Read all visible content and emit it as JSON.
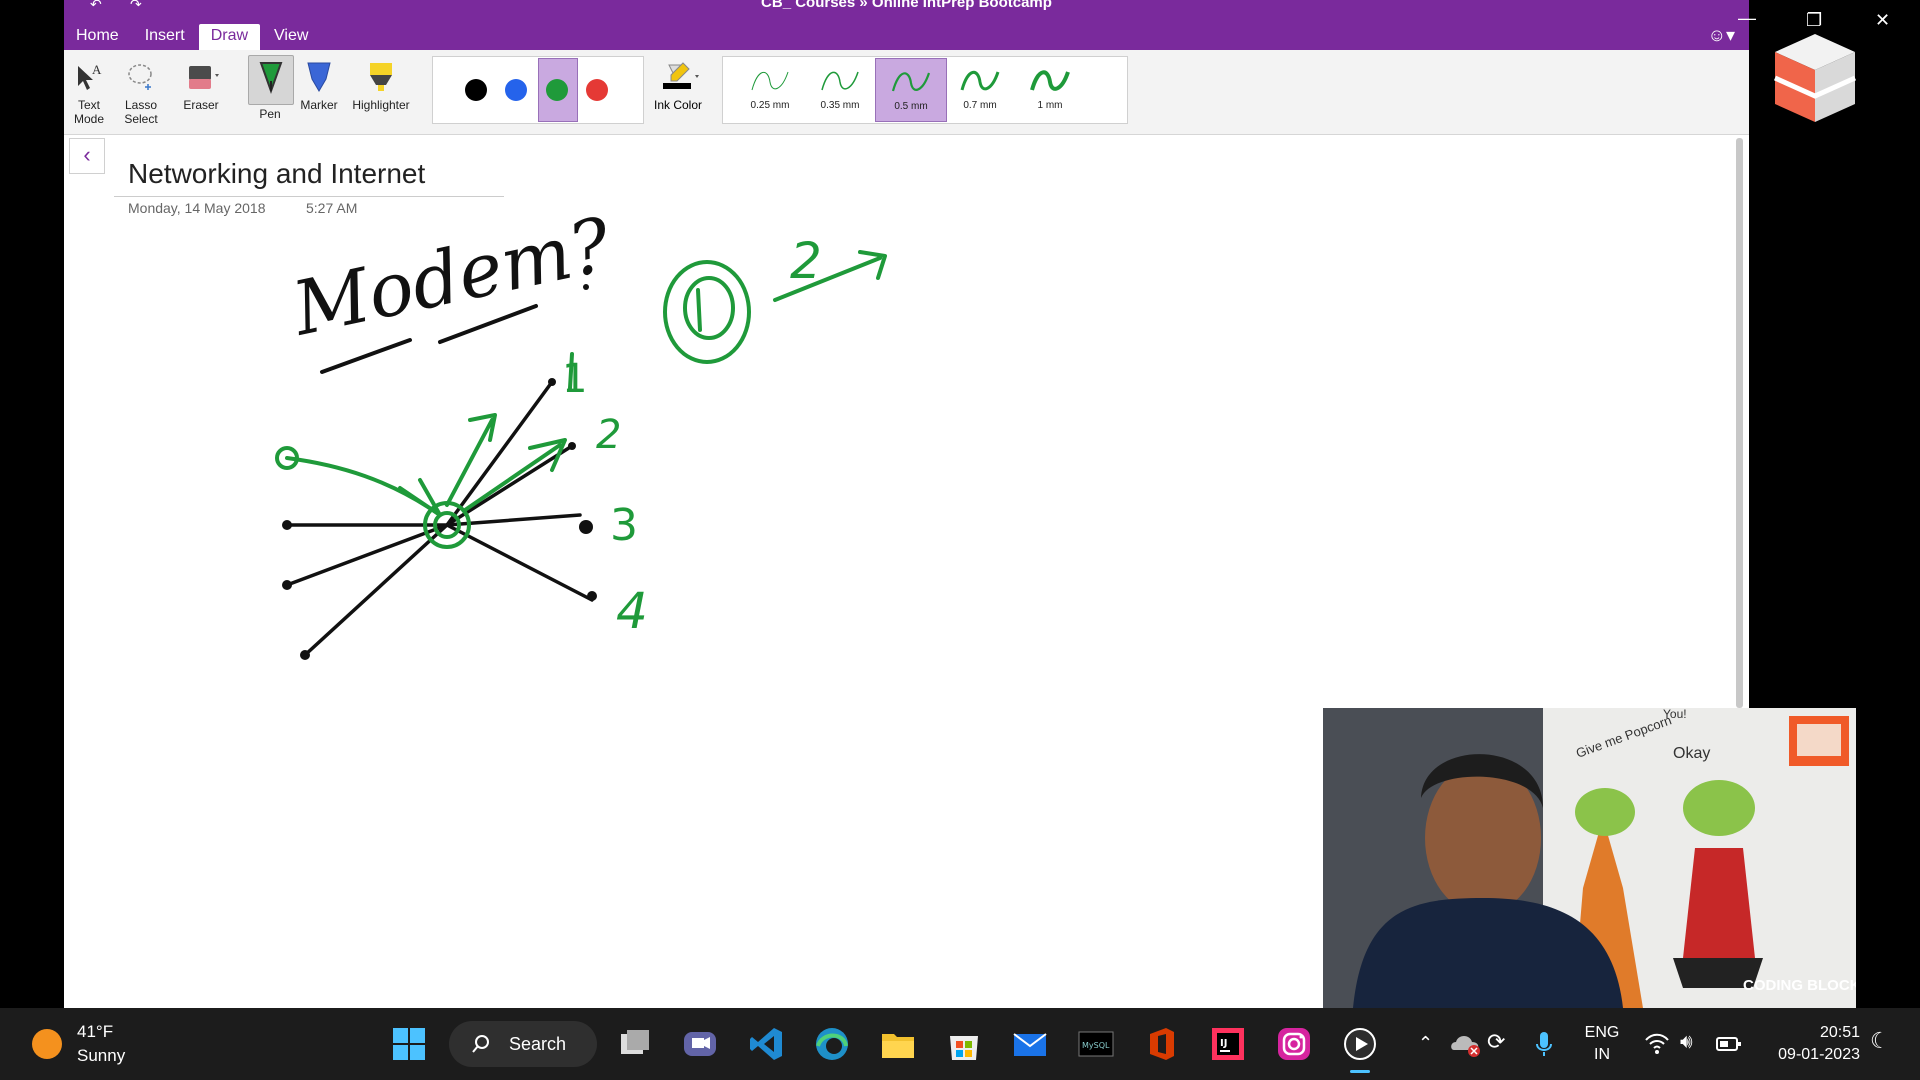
{
  "window": {
    "title": "CB_ Courses  »  Online IntPrep Bootcamp",
    "restore_glyph": "❐",
    "close_glyph": "✕",
    "minimize_glyph": "—"
  },
  "ribbon": {
    "tabs": [
      "Home",
      "Insert",
      "Draw",
      "View"
    ],
    "active_tab": "Draw",
    "tools": {
      "text_mode": "Text Mode",
      "lasso_select": "Lasso Select",
      "eraser": "Eraser",
      "pen": "Pen",
      "marker": "Marker",
      "highlighter": "Highlighter",
      "ink_color": "Ink Color"
    },
    "colors": [
      "#000000",
      "#2563eb",
      "#1f9a3a",
      "#e53935"
    ],
    "selected_color": "#1f9a3a",
    "thickness": [
      "0.25 mm",
      "0.35 mm",
      "0.5 mm",
      "0.7 mm",
      "1 mm"
    ],
    "selected_thickness": "0.5 mm"
  },
  "page": {
    "title": "Networking and Internet",
    "date": "Monday, 14 May 2018",
    "time": "5:27 AM"
  },
  "ink": {
    "heading": "Modem?",
    "port_labels": [
      "1",
      "2",
      "3",
      "4"
    ],
    "side_note": "2"
  },
  "webcam": {
    "brand": "CODING BLOCKS",
    "wall_text": [
      "Give me Popcorn",
      "Okay",
      "You!"
    ]
  },
  "taskbar": {
    "weather_temp": "41°F",
    "weather_desc": "Sunny",
    "search_label": "Search",
    "lang_primary": "ENG",
    "lang_secondary": "IN",
    "time": "20:51",
    "date": "09-01-2023"
  }
}
